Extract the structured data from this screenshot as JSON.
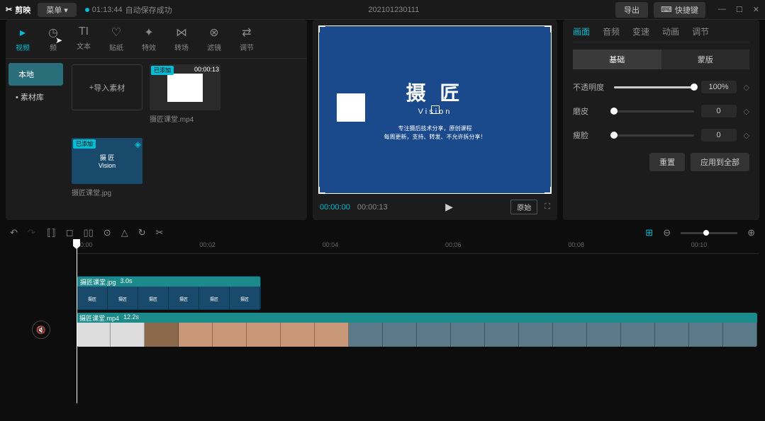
{
  "titlebar": {
    "app_name": "剪映",
    "menu": "菜单",
    "save_time": "01:13:44",
    "save_status": "自动保存成功",
    "project": "202101230111",
    "export": "导出",
    "shortcuts": "快捷键"
  },
  "media_tabs": [
    {
      "icon": "▸",
      "label": "视频",
      "active": true
    },
    {
      "icon": "◷",
      "label": "频"
    },
    {
      "icon": "TI",
      "label": "文本"
    },
    {
      "icon": "♡",
      "label": "贴纸"
    },
    {
      "icon": "✦",
      "label": "特效"
    },
    {
      "icon": "⋈",
      "label": "转场"
    },
    {
      "icon": "⊗",
      "label": "滤镜"
    },
    {
      "icon": "⇄",
      "label": "调节"
    }
  ],
  "media_sidebar": [
    {
      "label": "本地",
      "active": true
    },
    {
      "label": "• 素材库"
    }
  ],
  "import_label": "导入素材",
  "media_items": [
    {
      "name": "摄匠课堂.mp4",
      "duration": "00:00:13",
      "added": "已添加",
      "type": "video"
    },
    {
      "name": "摄匠课堂.jpg",
      "added": "已添加",
      "type": "image"
    }
  ],
  "preview": {
    "logo_main": "摄 匠",
    "logo_sub": "Vision",
    "text1": "专注摄后技术分享，原创课程",
    "text2": "每周更新，支持、转发、不允许拆分享！",
    "current_time": "00:00:00",
    "total_time": "00:00:13",
    "ratio": "原始"
  },
  "props": {
    "tabs": [
      "画面",
      "音频",
      "变速",
      "动画",
      "调节"
    ],
    "sub_tabs": [
      "基础",
      "蒙版"
    ],
    "opacity_label": "不透明度",
    "opacity_value": "100%",
    "skin_label": "磨皮",
    "skin_value": "0",
    "face_label": "瘦脸",
    "face_value": "0",
    "reset": "重置",
    "apply_all": "应用到全部"
  },
  "ruler_marks": [
    "00:00",
    "00:02",
    "00:04",
    "00:06",
    "00:08",
    "00:10"
  ],
  "clips": [
    {
      "name": "摄匠课堂.jpg",
      "duration": "3.0s"
    },
    {
      "name": "摄匠课堂.mp4",
      "duration": "12.2s"
    }
  ]
}
